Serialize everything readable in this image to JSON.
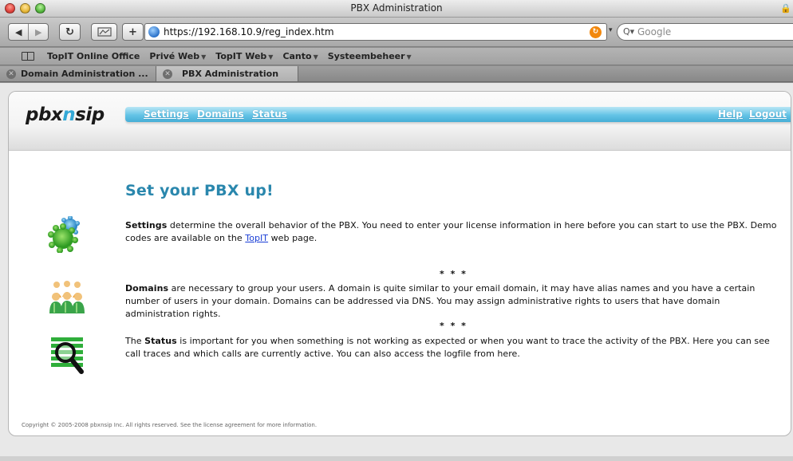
{
  "window": {
    "title": "PBX Administration"
  },
  "toolbar": {
    "url": "https://192.168.10.9/reg_index.htm",
    "search_placeholder": "Google",
    "rss_icon": "rss-icon"
  },
  "bookmarks": {
    "items": [
      {
        "label": "TopIT Online Office",
        "has_menu": false
      },
      {
        "label": "Privé Web",
        "has_menu": true
      },
      {
        "label": "TopIT Web",
        "has_menu": true
      },
      {
        "label": "Canto",
        "has_menu": true
      },
      {
        "label": "Systeembeheer",
        "has_menu": true
      }
    ]
  },
  "tabs": [
    {
      "label": "Domain Administration ...",
      "active": false
    },
    {
      "label": "PBX Administration",
      "active": true
    }
  ],
  "page": {
    "logo_prefix": "pbx",
    "logo_highlight": "n",
    "logo_suffix": "sip",
    "accent": "#2a87ad",
    "nav": {
      "settings": "Settings",
      "domains": "Domains",
      "status": "Status",
      "help": "Help",
      "logout": "Logout"
    },
    "heading": "Set your PBX up!",
    "sections": {
      "settings": {
        "bold": "Settings",
        "text": " determine the overall behavior of the PBX. You need to enter your license information in here before you can start to use the PBX. Demo codes are available on the ",
        "link": "TopIT",
        "tail": " web page."
      },
      "domains": {
        "bold": "Domains",
        "text": " are necessary to group your users. A domain is quite similar to your email domain, it may have alias names and you have a certain number of users in your domain. Domains can be addressed via DNS. You may assign administrative rights to users that have domain administration rights."
      },
      "status": {
        "prefix": "The ",
        "bold": "Status",
        "text": " is important for you when something is not working as expected or when you want to trace the activity of the PBX. Here you can see call traces and which calls are currently active. You can also access the logfile from here."
      }
    },
    "separator": "* * *",
    "footer": "Copyright © 2005-2008 pbxnsip Inc. All rights reserved. See the license agreement for more information."
  }
}
